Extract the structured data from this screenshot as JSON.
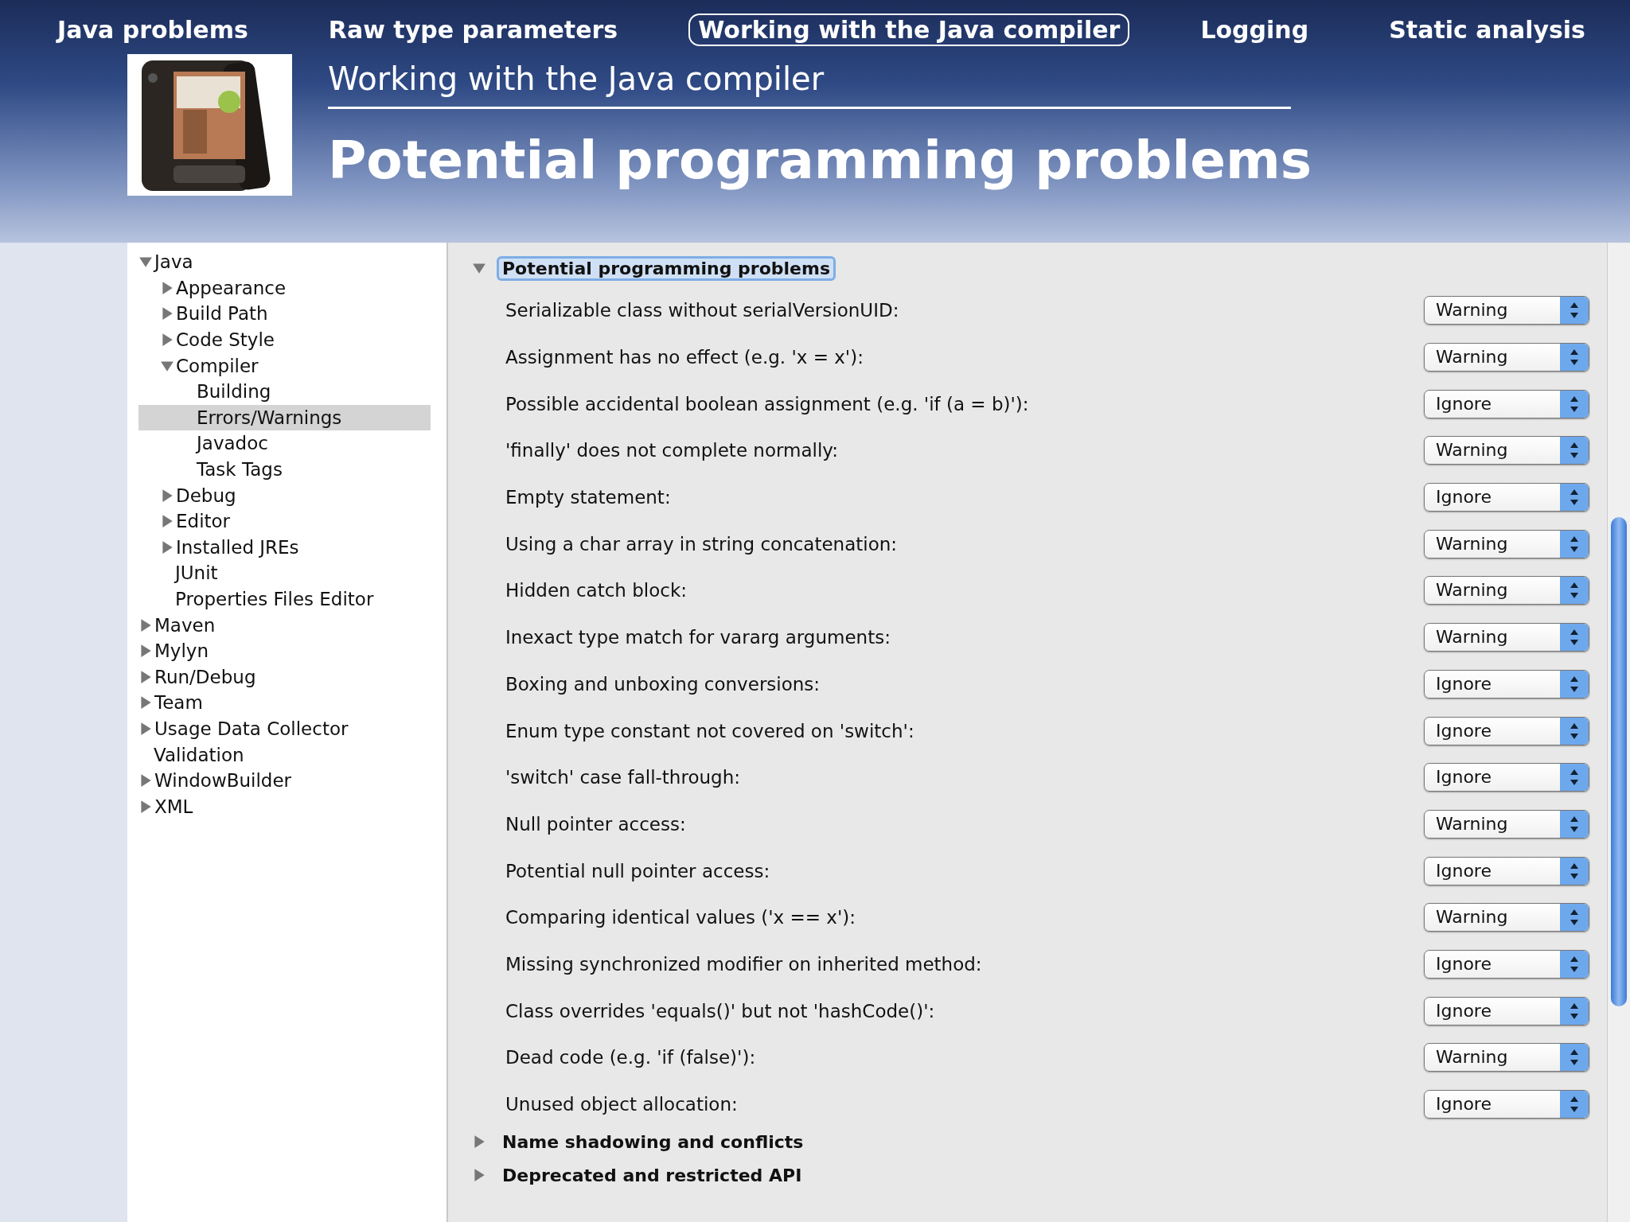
{
  "nav": [
    {
      "label": "Java problems",
      "selected": false
    },
    {
      "label": "Raw type parameters",
      "selected": false
    },
    {
      "label": "Working with the Java compiler",
      "selected": true
    },
    {
      "label": "Logging",
      "selected": false
    },
    {
      "label": "Static analysis",
      "selected": false
    }
  ],
  "subtitle": "Working with the Java compiler",
  "title": "Potential programming problems",
  "tree": [
    {
      "label": "Java",
      "expanded": true,
      "selected": false,
      "children": [
        {
          "label": "Appearance",
          "expanded": false,
          "selected": false
        },
        {
          "label": "Build Path",
          "expanded": false,
          "selected": false
        },
        {
          "label": "Code Style",
          "expanded": false,
          "selected": false
        },
        {
          "label": "Compiler",
          "expanded": true,
          "selected": false,
          "children": [
            {
              "label": "Building",
              "selected": false
            },
            {
              "label": "Errors/Warnings",
              "selected": true
            },
            {
              "label": "Javadoc",
              "selected": false
            },
            {
              "label": "Task Tags",
              "selected": false
            }
          ]
        },
        {
          "label": "Debug",
          "expanded": false,
          "selected": false
        },
        {
          "label": "Editor",
          "expanded": false,
          "selected": false
        },
        {
          "label": "Installed JREs",
          "expanded": false,
          "selected": false
        },
        {
          "label": "JUnit",
          "selected": false
        },
        {
          "label": "Properties Files Editor",
          "selected": false
        }
      ]
    },
    {
      "label": "Maven",
      "expanded": false,
      "selected": false
    },
    {
      "label": "Mylyn",
      "expanded": false,
      "selected": false
    },
    {
      "label": "Run/Debug",
      "expanded": false,
      "selected": false
    },
    {
      "label": "Team",
      "expanded": false,
      "selected": false
    },
    {
      "label": "Usage Data Collector",
      "expanded": false,
      "selected": false
    },
    {
      "label": "Validation",
      "selected": false
    },
    {
      "label": "WindowBuilder",
      "expanded": false,
      "selected": false
    },
    {
      "label": "XML",
      "expanded": false,
      "selected": false
    }
  ],
  "sections": [
    {
      "title": "Potential programming problems",
      "expanded": true,
      "focused": true,
      "options": [
        {
          "label": "Serializable class without serialVersionUID:",
          "value": "Warning"
        },
        {
          "label": "Assignment has no effect (e.g. 'x = x'):",
          "value": "Warning"
        },
        {
          "label": "Possible accidental boolean assignment (e.g. 'if (a = b)'):",
          "value": "Ignore"
        },
        {
          "label": "'finally' does not complete normally:",
          "value": "Warning"
        },
        {
          "label": "Empty statement:",
          "value": "Ignore"
        },
        {
          "label": "Using a char array in string concatenation:",
          "value": "Warning"
        },
        {
          "label": "Hidden catch block:",
          "value": "Warning"
        },
        {
          "label": "Inexact type match for vararg arguments:",
          "value": "Warning"
        },
        {
          "label": "Boxing and unboxing conversions:",
          "value": "Ignore"
        },
        {
          "label": "Enum type constant not covered on 'switch':",
          "value": "Ignore"
        },
        {
          "label": "'switch' case fall-through:",
          "value": "Ignore"
        },
        {
          "label": "Null pointer access:",
          "value": "Warning"
        },
        {
          "label": "Potential null pointer access:",
          "value": "Ignore"
        },
        {
          "label": "Comparing identical values ('x == x'):",
          "value": "Warning"
        },
        {
          "label": "Missing synchronized modifier on inherited method:",
          "value": "Ignore"
        },
        {
          "label": "Class overrides 'equals()' but not 'hashCode()':",
          "value": "Ignore"
        },
        {
          "label": "Dead code (e.g. 'if (false)'):",
          "value": "Warning"
        },
        {
          "label": "Unused object allocation:",
          "value": "Ignore"
        }
      ]
    },
    {
      "title": "Name shadowing and conflicts",
      "expanded": false,
      "focused": false
    },
    {
      "title": "Deprecated and restricted API",
      "expanded": false,
      "focused": false
    }
  ]
}
